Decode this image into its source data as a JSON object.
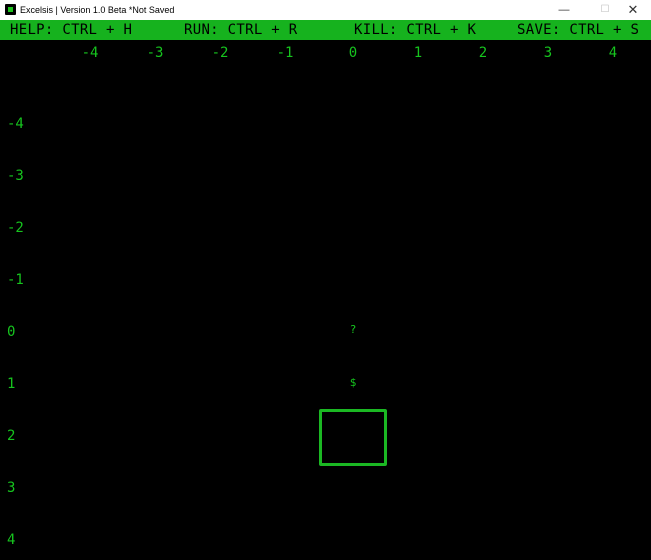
{
  "window": {
    "title": "Excelsis | Version 1.0 Beta   *Not Saved",
    "minimize_glyph": "—",
    "maximize_glyph": "☐",
    "close_glyph": "✕"
  },
  "menu": {
    "help": "HELP: CTRL + H",
    "run": "RUN: CTRL + R",
    "kill": "KILL: CTRL + K",
    "save": "SAVE: CTRL + S"
  },
  "grid": {
    "column_labels": [
      "-4",
      "-3",
      "-2",
      "-1",
      "0",
      "1",
      "2",
      "3",
      "4"
    ],
    "row_labels": [
      "-4",
      "-3",
      "-2",
      "-1",
      "0",
      "1",
      "2",
      "3",
      "4"
    ],
    "cells": [
      {
        "col": "0",
        "row": "0",
        "text": "?"
      },
      {
        "col": "0",
        "row": "1",
        "text": "$"
      }
    ],
    "selected_cell": {
      "col": "0",
      "row": "2"
    }
  },
  "colors": {
    "background": "#000000",
    "accent_green": "#16b21e",
    "text_green": "#16c41e"
  }
}
